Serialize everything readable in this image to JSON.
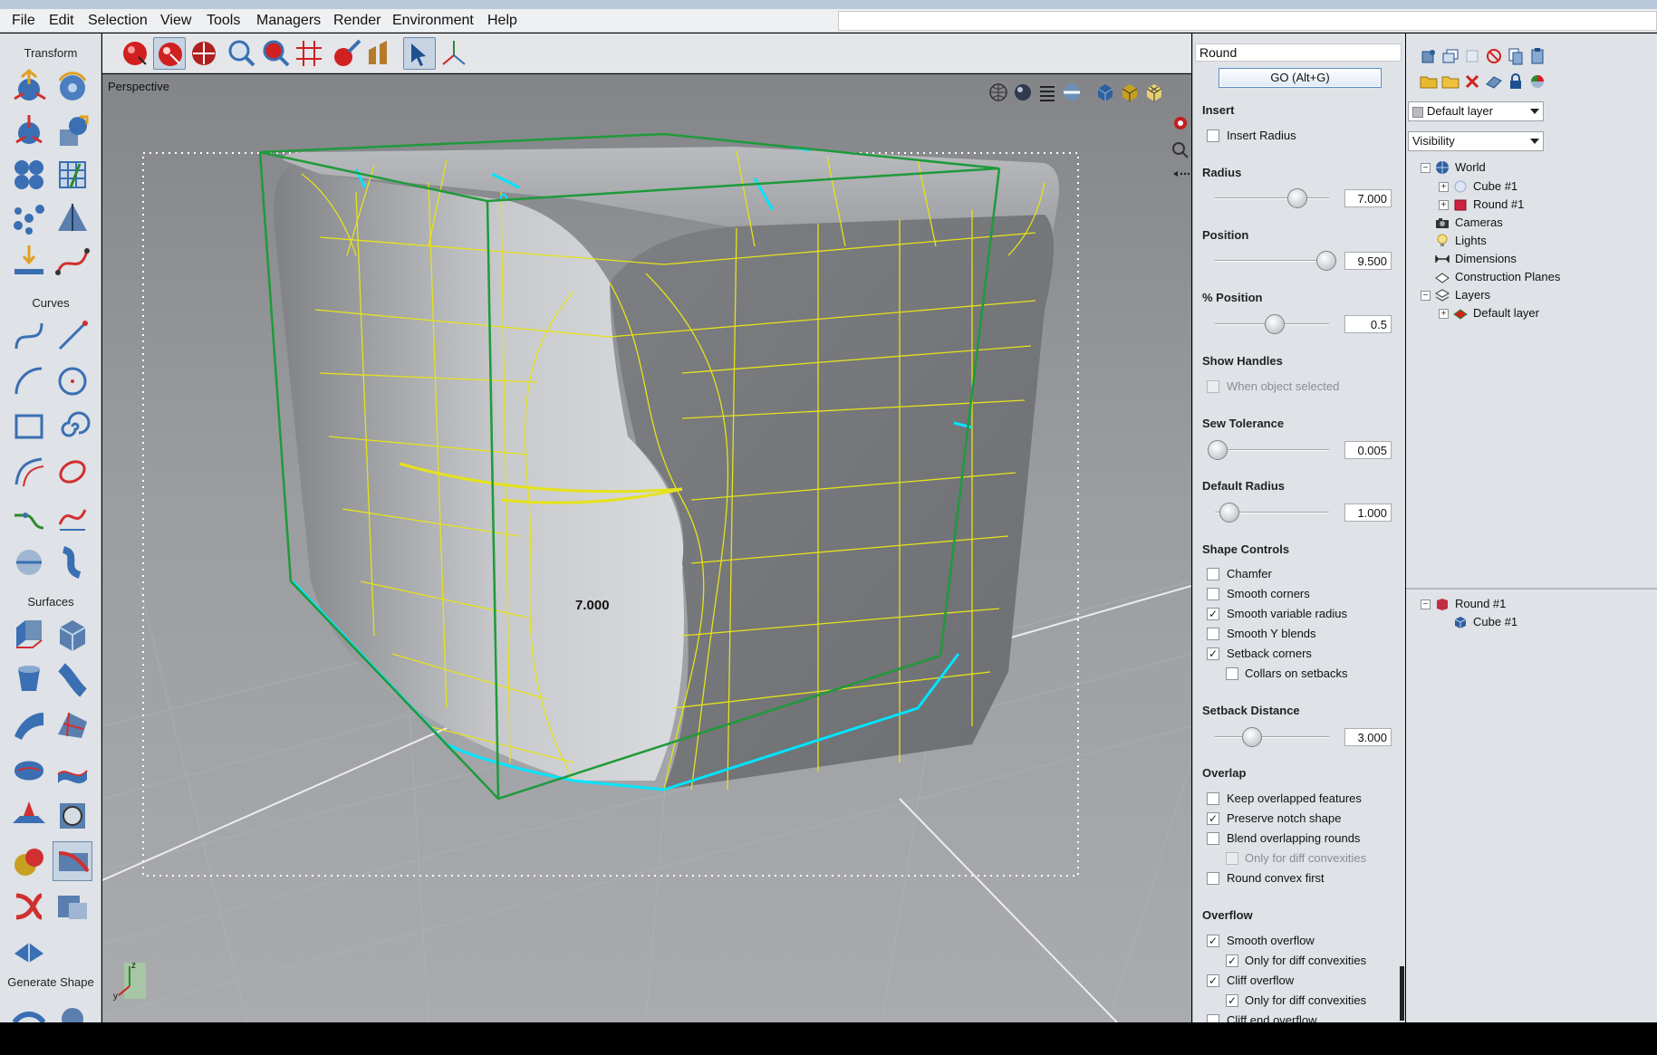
{
  "menubar": {
    "items": [
      "File",
      "Edit",
      "Selection",
      "View",
      "Tools",
      "Managers",
      "Render",
      "Environment",
      "Help"
    ]
  },
  "left_toolbox": {
    "sections": [
      "Transform",
      "Curves",
      "Surfaces",
      "Generate Shape"
    ]
  },
  "viewport": {
    "label": "Perspective",
    "radius_callout": "7.000",
    "top_icons": [
      "globe-icon",
      "sphere-shaded-icon",
      "list-icon",
      "half-sphere-icon",
      "cube-blue-icon",
      "cube-shaded-icon",
      "cube-wire-icon"
    ],
    "side_icons": [
      "record-icon",
      "zoom-icon",
      "more-icon"
    ],
    "colors": {
      "selection": "#1f9a3a",
      "edges": "#00e5ff",
      "isocurves": "#e6e21a"
    }
  },
  "props": {
    "title": "Round",
    "go_label": "GO (Alt+G)",
    "insert": {
      "heading": "Insert",
      "insert_radius": "Insert Radius"
    },
    "radius": {
      "heading": "Radius",
      "value": "7.000",
      "fraction": 0.7
    },
    "position": {
      "heading": "Position",
      "value": "9.500",
      "fraction": 0.95
    },
    "pct_position": {
      "heading": "% Position",
      "value": "0.5",
      "fraction": 0.5
    },
    "show_handles": {
      "heading": "Show Handles",
      "when_selected": "When object selected"
    },
    "sew_tolerance": {
      "heading": "Sew Tolerance",
      "value": "0.005",
      "fraction": 0.0
    },
    "default_radius": {
      "heading": "Default Radius",
      "value": "1.000",
      "fraction": 0.1
    },
    "shape_controls": {
      "heading": "Shape Controls",
      "chamfer": "Chamfer",
      "smooth_corners": "Smooth corners",
      "smooth_variable_radius": "Smooth variable radius",
      "smooth_y_blends": "Smooth Y blends",
      "setback_corners": "Setback corners",
      "collars_on_setbacks": "Collars on setbacks"
    },
    "setback_distance": {
      "heading": "Setback Distance",
      "value": "3.000",
      "fraction": 0.3
    },
    "overlap": {
      "heading": "Overlap",
      "keep_overlapped": "Keep overlapped features",
      "preserve_notch": "Preserve notch shape",
      "blend_overlapping": "Blend overlapping rounds",
      "only_diff": "Only for diff convexities",
      "round_convex_first": "Round convex first"
    },
    "overflow": {
      "heading": "Overflow",
      "smooth_overflow": "Smooth overflow",
      "only_diff_1": "Only for diff convexities",
      "cliff_overflow": "Cliff overflow",
      "only_diff_2": "Only for diff convexities",
      "cliff_end_overflow": "Cliff end overflow"
    }
  },
  "scene": {
    "layer_dropdown": "Default layer",
    "visibility_dropdown": "Visibility",
    "tree": {
      "world": "World",
      "cube1": "Cube #1",
      "round1": "Round #1",
      "cameras": "Cameras",
      "lights": "Lights",
      "dimensions": "Dimensions",
      "construction_planes": "Construction Planes",
      "layers": "Layers",
      "default_layer": "Default layer"
    },
    "history": {
      "round1": "Round #1",
      "cube1": "Cube #1"
    }
  }
}
